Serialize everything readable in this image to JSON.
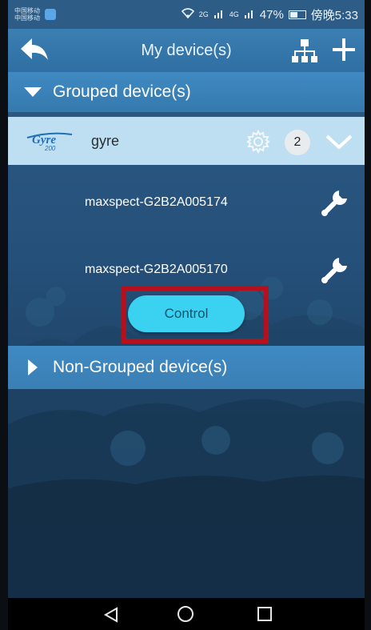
{
  "status_bar": {
    "carrier_line1": "中国移动",
    "carrier_line2": "中国移动",
    "network": "2G",
    "network2": "4G",
    "battery": "47%",
    "time": "傍晚5:33"
  },
  "header": {
    "title": "My device(s)"
  },
  "grouped": {
    "label": "Grouped device(s)",
    "group": {
      "logo_text": "Gyre",
      "logo_sub": "200",
      "name": "gyre",
      "count": "2"
    },
    "devices": [
      {
        "name": "maxspect-G2B2A005174"
      },
      {
        "name": "maxspect-G2B2A005170"
      }
    ],
    "control_label": "Control"
  },
  "non_grouped": {
    "label": "Non-Grouped device(s)"
  },
  "icons": {
    "back": "back-arrow-icon",
    "tree": "network-tree-icon",
    "add": "plus-icon",
    "gear": "gear-icon",
    "chevron": "chevron-down-icon",
    "wrench": "wrench-icon"
  },
  "colors": {
    "header": "#2f6fa3",
    "section": "#3f8ac2",
    "group_row": "#bedff2",
    "control": "#3ad2f0",
    "highlight": "#b6101d"
  }
}
